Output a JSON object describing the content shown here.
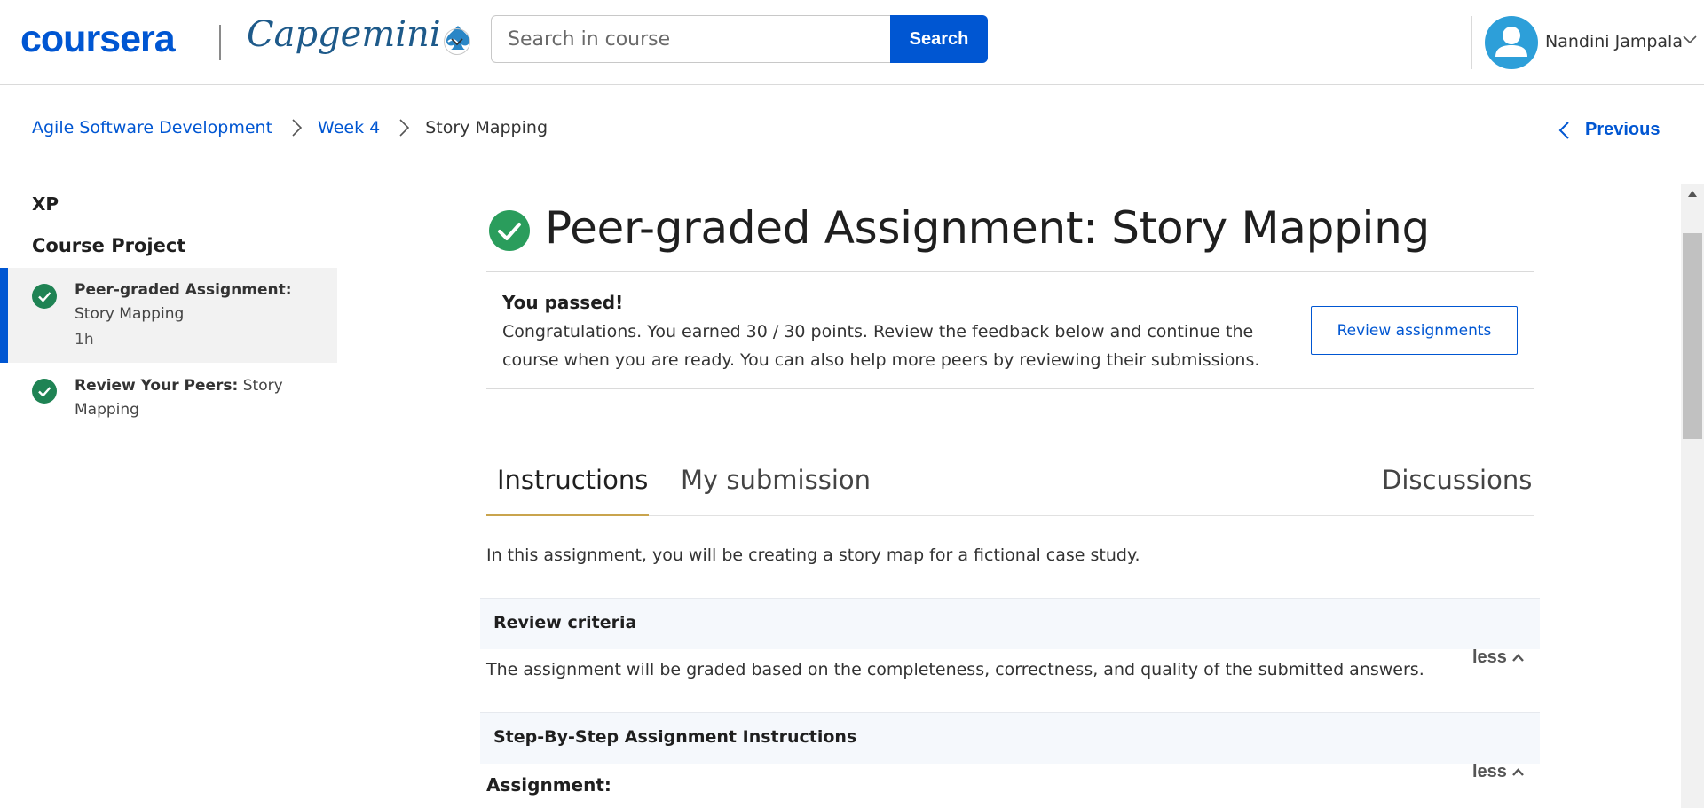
{
  "header": {
    "brand": "coursera",
    "partner": "Capgemini",
    "search_placeholder": "Search in course",
    "search_button": "Search",
    "user_name": "Nandini Jampala",
    "brand_color": "#0056d2"
  },
  "breadcrumb": {
    "items": [
      "Agile Software Development",
      "Week 4",
      "Story Mapping"
    ],
    "previous": "Previous"
  },
  "sidebar": {
    "xp": "XP",
    "section": "Course Project",
    "items": [
      {
        "bold": "Peer-graded Assignment:",
        "rest": "Story Mapping",
        "duration": "1h",
        "status": "completed",
        "active": true
      },
      {
        "bold": "Review Your Peers:",
        "rest": " Story Mapping",
        "status": "completed",
        "active": false
      }
    ]
  },
  "main": {
    "title": "Peer-graded Assignment: Story Mapping",
    "pass": {
      "heading": "You passed!",
      "message": "Congratulations. You earned 30 / 30 points. Review the feedback below and continue the course when you are ready. You can also help more peers by reviewing their submissions.",
      "button": "Review assignments"
    },
    "tabs": [
      "Instructions",
      "My submission",
      "Discussions"
    ],
    "active_tab": "Instructions",
    "intro": "In this assignment, you will be creating a story map for a fictional case study.",
    "sections": [
      {
        "heading": "Review criteria",
        "toggle": "less",
        "body": "The assignment will be graded based on the completeness, correctness, and quality of the submitted answers."
      },
      {
        "heading": "Step-By-Step Assignment Instructions",
        "toggle": "less",
        "body": "Assignment:"
      }
    ]
  },
  "icons": {
    "completed": "check-circle-icon",
    "completed_color": "#1f8354",
    "title_check_color": "#2a9d5c"
  }
}
